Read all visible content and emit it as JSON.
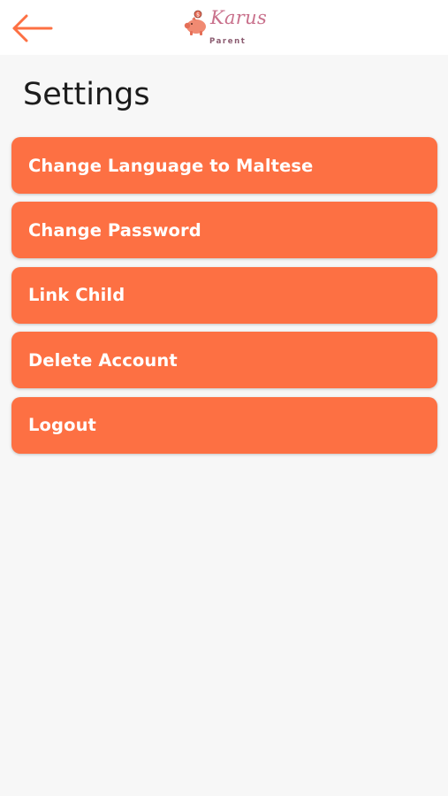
{
  "header": {
    "back_icon": "arrow-left-icon",
    "logo_icon": "piggy-bank-icon",
    "app_name": "Karus",
    "app_subtitle": "Parent",
    "accent_color": "#fd7043"
  },
  "page": {
    "title": "Settings"
  },
  "menu": {
    "items": [
      {
        "label": "Change Language to Maltese"
      },
      {
        "label": "Change Password"
      },
      {
        "label": "Link Child"
      },
      {
        "label": "Delete Account"
      },
      {
        "label": "Logout"
      }
    ]
  }
}
